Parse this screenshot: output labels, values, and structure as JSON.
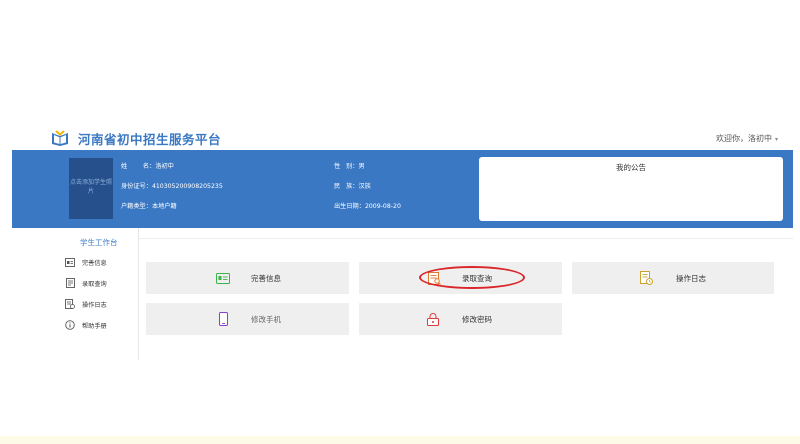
{
  "header": {
    "title": "河南省初中招生服务平台",
    "welcome": "欢迎你，洛初中",
    "caret": "▾"
  },
  "student": {
    "photo_text": "点击添加学生照片",
    "name_label": "姓        名：",
    "name": "洛初中",
    "id_label": "身份证号：",
    "id": "410305200908205235",
    "household_label": "户籍类型：",
    "household": "本地户籍",
    "gender_label": "性   别：",
    "gender": "男",
    "ethnicity_label": "民   族：",
    "ethnicity": "汉族",
    "birth_label": "出生日期：",
    "birth": "2009-08-20"
  },
  "notice": {
    "title": "我的公告"
  },
  "sidebar": {
    "title": "学生工作台",
    "items": [
      {
        "label": "完善信息",
        "icon": "id-card-icon"
      },
      {
        "label": "录取查询",
        "icon": "search-doc-icon"
      },
      {
        "label": "操作日志",
        "icon": "log-icon"
      },
      {
        "label": "帮助手册",
        "icon": "info-icon"
      }
    ]
  },
  "cards": [
    {
      "label": "完善信息",
      "icon": "id-card-icon"
    },
    {
      "label": "录取查询",
      "icon": "search-doc-icon"
    },
    {
      "label": "操作日志",
      "icon": "log-icon"
    },
    {
      "label": "修改手机",
      "icon": "phone-icon"
    },
    {
      "label": "修改密码",
      "icon": "lock-icon"
    }
  ],
  "colors": {
    "brand": "#3a78c4",
    "card_bg": "#efefef",
    "highlight": "#d9262a"
  }
}
